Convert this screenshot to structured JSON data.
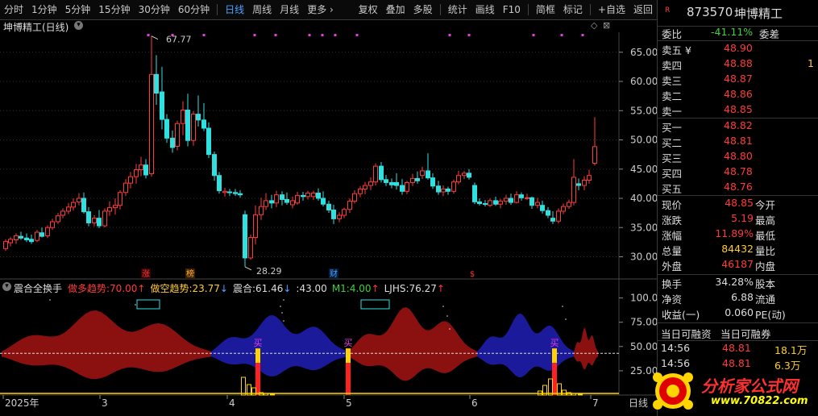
{
  "toolbar": {
    "periods": [
      "分时",
      "1分钟",
      "5分钟",
      "15分钟",
      "30分钟",
      "60分钟",
      "日线",
      "周线",
      "月线",
      "更多 ›"
    ],
    "active_period": "日线",
    "actions": [
      "复权",
      "叠加",
      "多股",
      "统计",
      "画线",
      "F10",
      "简框",
      "标记",
      "+自选",
      "返回"
    ]
  },
  "chart_title": "坤博精工(日线)",
  "main_chart": {
    "y_ticks": [
      "65.00",
      "60.00",
      "55.00",
      "50.00",
      "45.00",
      "40.00",
      "35.00",
      "30.00"
    ],
    "high_label": "67.77",
    "low_label": "28.29",
    "markers": [
      "涨",
      "榜",
      "财",
      "$"
    ]
  },
  "indicator": {
    "name": "震合全换手",
    "items": [
      {
        "label": "做多趋势:",
        "value": "70.00",
        "arrow": "↑",
        "color": "#ff3b3b"
      },
      {
        "label": "做空趋势:",
        "value": "23.77",
        "arrow": "↓",
        "color": "#ffcc33"
      },
      {
        "label": "震合:",
        "value": "61.46",
        "arrow": "↓",
        "color": "#dddddd"
      },
      {
        "label": ":",
        "value": "43.00",
        "arrow": "",
        "color": "#dddddd"
      },
      {
        "label": "M1:",
        "value": "4.00",
        "arrow": "↑",
        "color": "#3fd03f"
      },
      {
        "label": "LJHS:",
        "value": "76.27",
        "arrow": "↑",
        "color": "#dddddd"
      }
    ],
    "y_ticks": [
      "100.0",
      "75.00",
      "50.00",
      "25.00"
    ],
    "buy_label": "买"
  },
  "x_axis": {
    "labels": [
      "2025年",
      "3",
      "4",
      "5",
      "6",
      "7"
    ],
    "period": "日线"
  },
  "quote": {
    "code": "873570",
    "name": "坤博精工",
    "badge": "R",
    "weibi_label": "委比",
    "weibi": "-41.11%",
    "weicha_label": "委差",
    "asks": [
      {
        "label": "卖五 ¥",
        "price": "48.90"
      },
      {
        "label": "卖四",
        "price": "48.88",
        "vol": "1"
      },
      {
        "label": "卖三",
        "price": "48.87"
      },
      {
        "label": "卖二",
        "price": "48.86"
      },
      {
        "label": "卖一",
        "price": "48.85"
      }
    ],
    "bids": [
      {
        "label": "买一",
        "price": "48.82"
      },
      {
        "label": "买二",
        "price": "48.81"
      },
      {
        "label": "买三",
        "price": "48.80"
      },
      {
        "label": "买四",
        "price": "48.78"
      },
      {
        "label": "买五",
        "price": "48.76"
      }
    ],
    "stats": [
      {
        "l1": "现价",
        "v1": "48.85",
        "c1": "red",
        "l2": "今开"
      },
      {
        "l1": "涨跌",
        "v1": "5.19",
        "c1": "red",
        "l2": "最高"
      },
      {
        "l1": "涨幅",
        "v1": "11.89%",
        "c1": "red",
        "l2": "最低"
      },
      {
        "l1": "总量",
        "v1": "84432",
        "c1": "yellow",
        "l2": "量比"
      },
      {
        "l1": "外盘",
        "v1": "46187",
        "c1": "red",
        "l2": "内盘"
      }
    ],
    "stats2": [
      {
        "l1": "换手",
        "v1": "34.28%",
        "l2": "股本"
      },
      {
        "l1": "净资",
        "v1": "6.88",
        "l2": "流通"
      },
      {
        "l1": "收益(一)",
        "v1": "0.060",
        "l2": "PE(动)"
      }
    ],
    "margin_header": [
      "当日可融资",
      "当日可融券"
    ],
    "ticks": [
      {
        "time": "14:56",
        "price": "48.81",
        "vol": "18.1万"
      },
      {
        "time": "14:56",
        "price": "48.81",
        "vol": "6.3万"
      }
    ]
  },
  "logo": {
    "text": "分析家公式网",
    "url": "www.70822.com"
  }
}
